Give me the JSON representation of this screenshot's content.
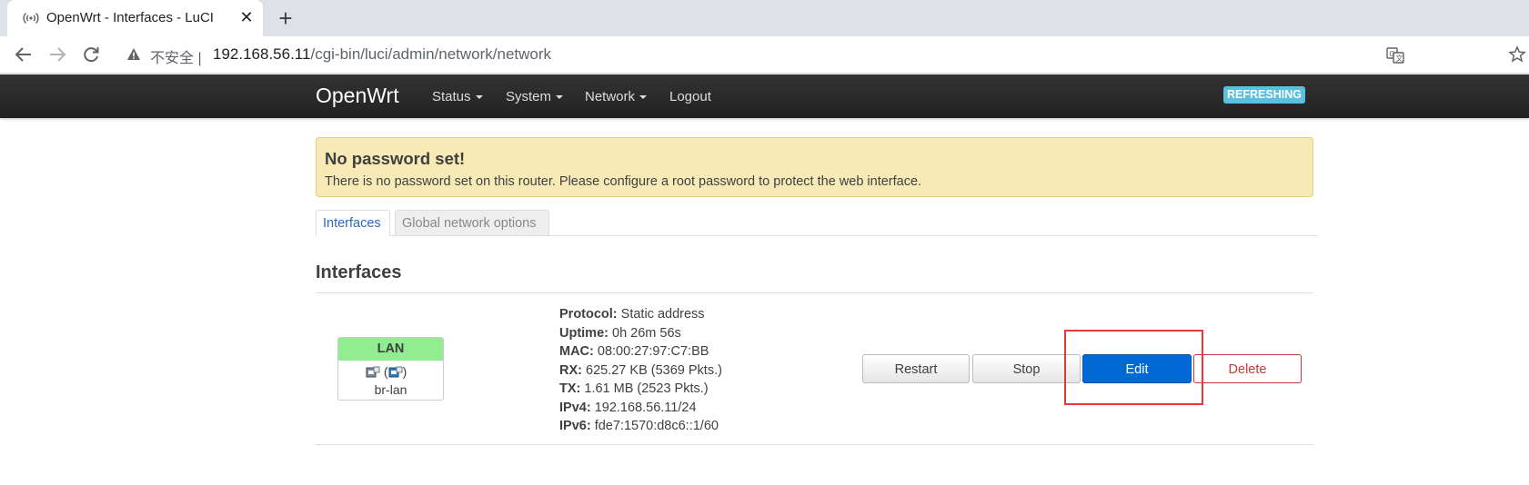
{
  "browser": {
    "tab_title": "OpenWrt - Interfaces - LuCI",
    "tab_close": "✕",
    "new_tab": "+",
    "security_label": "不安全",
    "url_host": "192.168.56.11",
    "url_path": "/cgi-bin/luci/admin/network/network"
  },
  "header": {
    "brand": "OpenWrt",
    "menu": [
      "Status",
      "System",
      "Network",
      "Logout"
    ],
    "indicator": "REFRESHING"
  },
  "alert": {
    "title": "No password set!",
    "message": "There is no password set on this router. Please configure a root password to protect the web interface."
  },
  "tabs": [
    "Interfaces",
    "Global network options"
  ],
  "section_title": "Interfaces",
  "interface": {
    "name": "LAN",
    "device": "br-lan",
    "color": "#90ee90",
    "status": [
      {
        "key": "Protocol:",
        "value": "Static address"
      },
      {
        "key": "Uptime:",
        "value": "0h 26m 56s"
      },
      {
        "key": "MAC:",
        "value": "08:00:27:97:C7:BB"
      },
      {
        "key": "RX:",
        "value": "625.27 KB (5369 Pkts.)"
      },
      {
        "key": "TX:",
        "value": "1.61 MB (2523 Pkts.)"
      },
      {
        "key": "IPv4:",
        "value": "192.168.56.11/24"
      },
      {
        "key": "IPv6:",
        "value": "fde7:1570:d8c6::1/60"
      }
    ]
  },
  "actions": {
    "restart": "Restart",
    "stop": "Stop",
    "edit": "Edit",
    "delete": "Delete"
  },
  "colors": {
    "accent": "#0069d6",
    "danger": "#c43c35",
    "highlight": "#e53935",
    "info": "#5bc0de"
  }
}
